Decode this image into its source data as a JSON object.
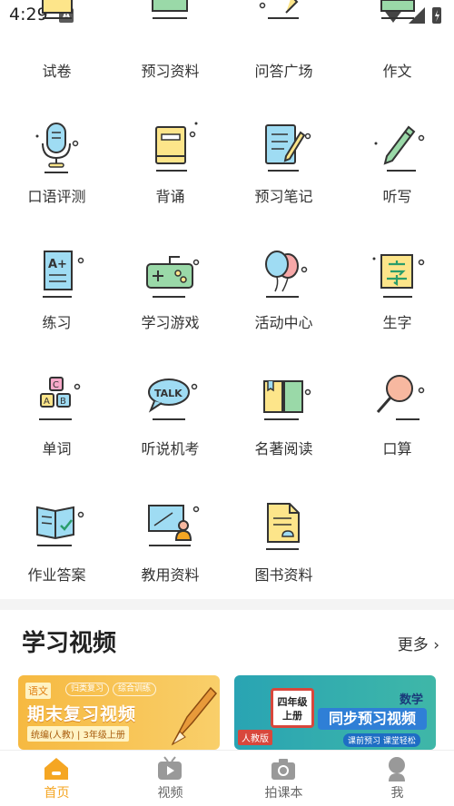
{
  "status_bar": {
    "time": "4:29",
    "notif_letter": "A"
  },
  "grid": {
    "items": [
      {
        "label": "试卷",
        "icon": "exam-paper-icon"
      },
      {
        "label": "预习资料",
        "icon": "books-stack-icon"
      },
      {
        "label": "问答广场",
        "icon": "qa-notebook-icon"
      },
      {
        "label": "作文",
        "icon": "writing-icon"
      },
      {
        "label": "口语评测",
        "icon": "microphone-icon"
      },
      {
        "label": "背诵",
        "icon": "book-icon"
      },
      {
        "label": "预习笔记",
        "icon": "notebook-pencil-icon"
      },
      {
        "label": "听写",
        "icon": "pen-icon"
      },
      {
        "label": "练习",
        "icon": "grade-paper-icon"
      },
      {
        "label": "学习游戏",
        "icon": "gamepad-icon"
      },
      {
        "label": "活动中心",
        "icon": "balloons-icon"
      },
      {
        "label": "生字",
        "icon": "character-card-icon"
      },
      {
        "label": "单词",
        "icon": "abc-blocks-icon"
      },
      {
        "label": "听说机考",
        "icon": "talk-bubble-icon"
      },
      {
        "label": "名著阅读",
        "icon": "open-book-icon"
      },
      {
        "label": "口算",
        "icon": "magnifier-icon"
      },
      {
        "label": "作业答案",
        "icon": "answer-book-icon"
      },
      {
        "label": "教用资料",
        "icon": "teacher-board-icon"
      },
      {
        "label": "图书资料",
        "icon": "document-icon"
      }
    ]
  },
  "video_section": {
    "title": "学习视频",
    "more": "更多",
    "banners": [
      {
        "tag": "语文",
        "chips": [
          "归类复习",
          "综合训练"
        ],
        "title": "期末复习视频",
        "subtitle": "统编(人教) | 3年级上册"
      },
      {
        "badge_line1": "四年级",
        "badge_line2": "上册",
        "edition": "人教版",
        "subject": "数学",
        "title": "同步预习视频",
        "subtitle": "课前预习 课堂轻松"
      }
    ]
  },
  "bottom_nav": {
    "items": [
      {
        "label": "首页",
        "icon": "home-icon",
        "active": true
      },
      {
        "label": "视频",
        "icon": "tv-icon",
        "active": false
      },
      {
        "label": "拍课本",
        "icon": "camera-icon",
        "active": false
      },
      {
        "label": "我",
        "icon": "profile-icon",
        "active": false
      }
    ]
  },
  "colors": {
    "accent": "#f5a623",
    "icon_yellow": "#fde58a",
    "icon_blue": "#9fdcf3",
    "icon_green": "#9ad9a8",
    "icon_outline": "#333333"
  }
}
